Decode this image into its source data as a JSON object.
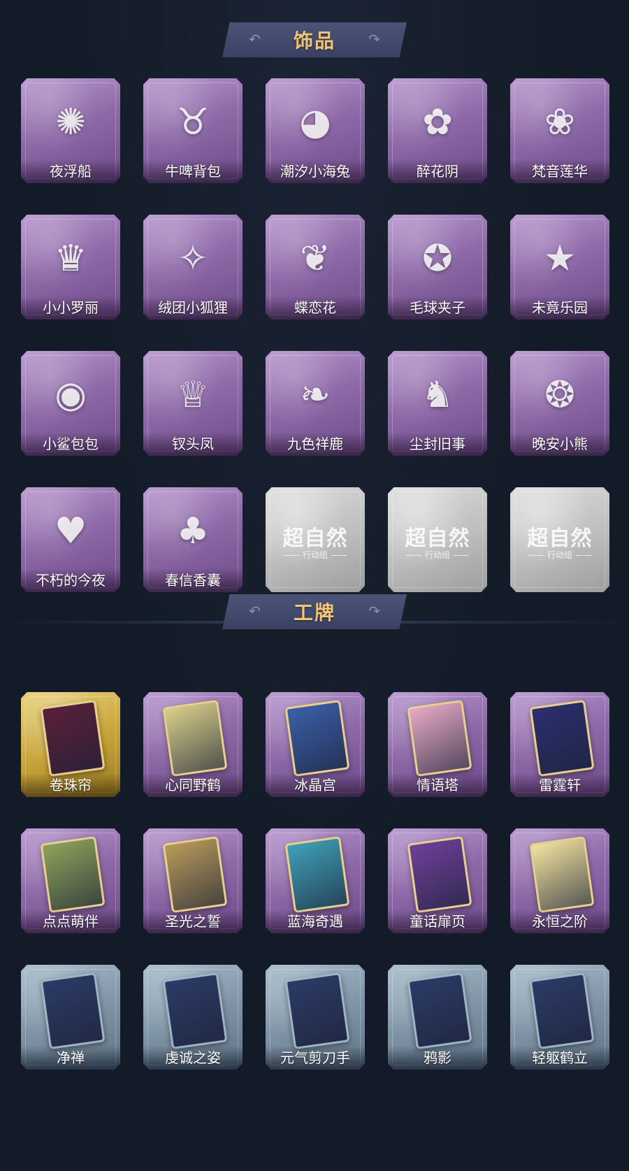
{
  "sections": [
    {
      "title": "饰品",
      "items": [
        {
          "label": "夜浮船",
          "rarity": "purple",
          "icon": "jellyfish-icon",
          "glyph": "✺"
        },
        {
          "label": "牛啤背包",
          "rarity": "purple",
          "icon": "cow-mug-icon",
          "glyph": "♉"
        },
        {
          "label": "潮汐小海兔",
          "rarity": "purple",
          "icon": "sea-bunny-icon",
          "glyph": "◕"
        },
        {
          "label": "醉花阴",
          "rarity": "purple",
          "icon": "flower-ornament-icon",
          "glyph": "✿"
        },
        {
          "label": "梵音莲华",
          "rarity": "purple",
          "icon": "lotus-doll-icon",
          "glyph": "❀"
        },
        {
          "label": "小小罗丽",
          "rarity": "purple",
          "icon": "doll-girl-icon",
          "glyph": "♛"
        },
        {
          "label": "绒团小狐狸",
          "rarity": "purple",
          "icon": "fox-plush-icon",
          "glyph": "✧"
        },
        {
          "label": "蝶恋花",
          "rarity": "purple",
          "icon": "bell-ornament-icon",
          "glyph": "❦"
        },
        {
          "label": "毛球夹子",
          "rarity": "purple",
          "icon": "raccoon-clip-icon",
          "glyph": "✪"
        },
        {
          "label": "未竟乐园",
          "rarity": "purple",
          "icon": "star-doll-icon",
          "glyph": "★"
        },
        {
          "label": "小鲨包包",
          "rarity": "purple",
          "icon": "shark-bag-icon",
          "glyph": "◉"
        },
        {
          "label": "钗头凤",
          "rarity": "purple",
          "icon": "phoenix-crown-icon",
          "glyph": "♕"
        },
        {
          "label": "九色祥鹿",
          "rarity": "purple",
          "icon": "deer-charm-icon",
          "glyph": "❧"
        },
        {
          "label": "尘封旧事",
          "rarity": "purple",
          "icon": "boy-keychain-icon",
          "glyph": "♞"
        },
        {
          "label": "晚安小熊",
          "rarity": "purple",
          "icon": "bear-keychain-icon",
          "glyph": "❂"
        },
        {
          "label": "不朽的今夜",
          "rarity": "purple",
          "icon": "cat-bowl-icon",
          "glyph": "♥"
        },
        {
          "label": "春信香囊",
          "rarity": "purple",
          "icon": "sachet-icon",
          "glyph": "♣"
        },
        {
          "label": "",
          "rarity": "locked",
          "icon": "locked-placeholder-icon",
          "watermark": "超自然",
          "sub": "—— 行动组 ——"
        },
        {
          "label": "",
          "rarity": "locked",
          "icon": "locked-placeholder-icon",
          "watermark": "超自然",
          "sub": "—— 行动组 ——"
        },
        {
          "label": "",
          "rarity": "locked",
          "icon": "locked-placeholder-icon",
          "watermark": "超自然",
          "sub": "—— 行动组 ——"
        }
      ]
    },
    {
      "title": "工牌",
      "items": [
        {
          "label": "卷珠帘",
          "rarity": "gold",
          "icon": "badge-card-icon",
          "art": "#5a1f3a"
        },
        {
          "label": "心同野鹤",
          "rarity": "purple",
          "icon": "badge-card-icon",
          "art": "#d8cf8a"
        },
        {
          "label": "冰晶宫",
          "rarity": "purple",
          "icon": "badge-card-icon",
          "art": "#3b5fa8"
        },
        {
          "label": "情语塔",
          "rarity": "purple",
          "icon": "badge-card-icon",
          "art": "#e7a9c6"
        },
        {
          "label": "雷霆轩",
          "rarity": "purple",
          "icon": "badge-card-icon",
          "art": "#2b2f6e"
        },
        {
          "label": "点点萌伴",
          "rarity": "purple",
          "icon": "badge-card-icon",
          "art": "#8da35a"
        },
        {
          "label": "圣光之誓",
          "rarity": "purple",
          "icon": "badge-card-icon",
          "art": "#b89a5a"
        },
        {
          "label": "蓝海奇遇",
          "rarity": "purple",
          "icon": "badge-card-icon",
          "art": "#3fa0b8"
        },
        {
          "label": "童话扉页",
          "rarity": "purple",
          "icon": "badge-card-icon",
          "art": "#6e3f9a"
        },
        {
          "label": "永恒之阶",
          "rarity": "purple",
          "icon": "badge-card-icon",
          "art": "#f2e3a0"
        },
        {
          "label": "净禅",
          "rarity": "blue",
          "icon": "badge-silhouette-icon",
          "art": "#2c3a66"
        },
        {
          "label": "虔诚之姿",
          "rarity": "blue",
          "icon": "badge-silhouette-icon",
          "art": "#2c3a66"
        },
        {
          "label": "元气剪刀手",
          "rarity": "blue",
          "icon": "badge-silhouette-icon",
          "art": "#2c3a66"
        },
        {
          "label": "鸦影",
          "rarity": "blue",
          "icon": "badge-silhouette-icon",
          "art": "#2c3a66"
        },
        {
          "label": "轻躯鹤立",
          "rarity": "blue",
          "icon": "badge-silhouette-icon",
          "art": "#2c3a66"
        }
      ]
    }
  ],
  "banner_deco": {
    "left": "↶",
    "right": "↷"
  },
  "colors": {
    "background": "#141b28",
    "banner": "#454d70",
    "banner_text": "#f2c572",
    "purple": "#8f6aa8",
    "gold": "#c9a63c",
    "blue": "#7f94a6",
    "locked": "#bdbdbd"
  }
}
